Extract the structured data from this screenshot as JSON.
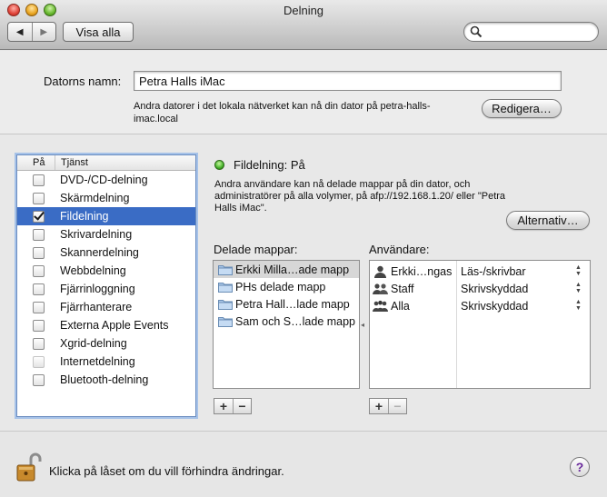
{
  "window": {
    "title": "Delning"
  },
  "toolbar": {
    "back_glyph": "◀",
    "forward_glyph": "▶",
    "show_all_label": "Visa alla",
    "search_value": ""
  },
  "computer_name": {
    "label": "Datorns namn:",
    "value": "Petra Halls iMac",
    "note": "Andra datorer i det lokala nätverket kan nå din dator på petra-halls-imac.local",
    "edit_button": "Redigera…"
  },
  "services": {
    "header_on": "På",
    "header_service": "Tjänst",
    "items": [
      {
        "label": "DVD-/CD-delning",
        "checked": false
      },
      {
        "label": "Skärmdelning",
        "checked": false
      },
      {
        "label": "Fildelning",
        "checked": true,
        "selected": true
      },
      {
        "label": "Skrivardelning",
        "checked": false
      },
      {
        "label": "Skannerdelning",
        "checked": false
      },
      {
        "label": "Webbdelning",
        "checked": false
      },
      {
        "label": "Fjärrinloggning",
        "checked": false
      },
      {
        "label": "Fjärrhanterare",
        "checked": false
      },
      {
        "label": "Externa Apple Events",
        "checked": false
      },
      {
        "label": "Xgrid-delning",
        "checked": false
      },
      {
        "label": "Internetdelning",
        "checked": false,
        "dimmed": true
      },
      {
        "label": "Bluetooth-delning",
        "checked": false
      }
    ]
  },
  "status": {
    "title": "Fildelning: På",
    "description": "Andra användare kan nå delade mappar på din dator, och administratörer på alla volymer, på afp://192.168.1.20/ eller \"Petra Halls iMac\".",
    "options_button": "Alternativ…",
    "indicator_color": "#45b22a"
  },
  "shared_folders": {
    "label": "Delade mappar:",
    "items": [
      {
        "label": "Erkki Milla…ade mapp",
        "selected": true
      },
      {
        "label": "PHs delade mapp"
      },
      {
        "label": "Petra Hall…lade mapp"
      },
      {
        "label": "Sam och S…lade mapp"
      }
    ],
    "add": "+",
    "remove": "−"
  },
  "users": {
    "label": "Användare:",
    "items": [
      {
        "name": "Erkki…ngas",
        "permission": "Läs-/skrivbar",
        "icon": "single-user-icon"
      },
      {
        "name": "Staff",
        "permission": "Skrivskyddad",
        "icon": "group-icon"
      },
      {
        "name": "Alla",
        "permission": "Skrivskyddad",
        "icon": "everyone-icon"
      }
    ],
    "add": "+",
    "remove": "−",
    "stepper_glyph": "▲▼"
  },
  "footer": {
    "lock_text": "Klicka på låset om du vill förhindra ändringar.",
    "help_glyph": "?"
  },
  "colors": {
    "selection": "#3a6cc5",
    "focus_ring": "#a6c2e8"
  }
}
